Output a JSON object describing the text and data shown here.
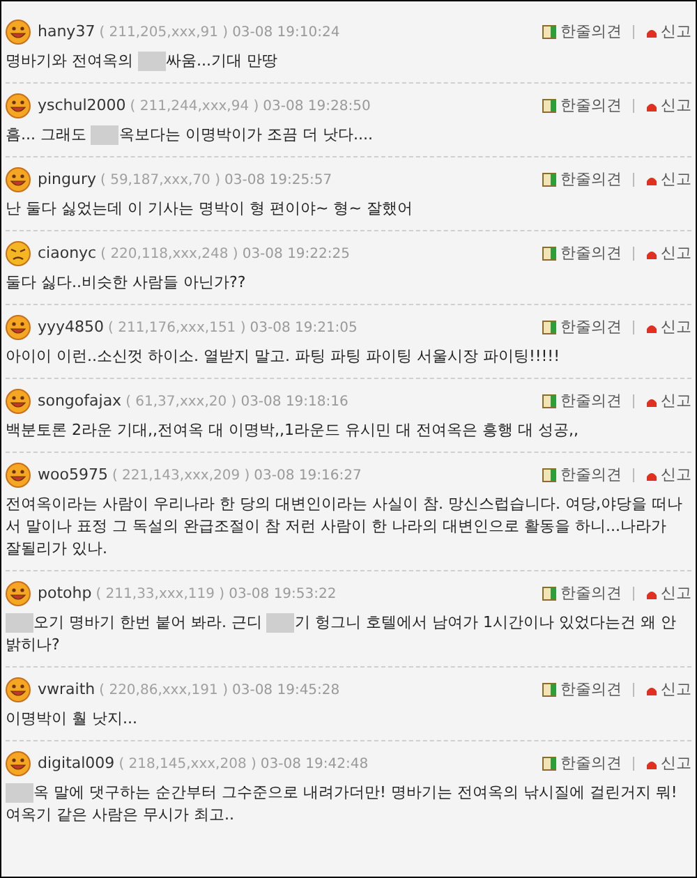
{
  "comments": [
    {
      "user": "hany37",
      "ip": "( 211,205,xxx,91 )",
      "time": "03-08 19:10:24",
      "frowning": false,
      "reply": "한줄의견",
      "report": "신고",
      "body": [
        {
          "kind": "text",
          "text": "명바기와 전여옥의 "
        },
        {
          "kind": "mask"
        },
        {
          "kind": "text",
          "text": "싸움...기대 만땅"
        }
      ]
    },
    {
      "user": "yschul2000",
      "ip": "( 211,244,xxx,94 )",
      "time": "03-08 19:28:50",
      "frowning": false,
      "reply": "한줄의견",
      "report": "신고",
      "body": [
        {
          "kind": "text",
          "text": "흠... 그래도 "
        },
        {
          "kind": "mask"
        },
        {
          "kind": "text",
          "text": "옥보다는 이명박이가 조끔 더 낫다...."
        }
      ]
    },
    {
      "user": "pingury",
      "ip": "( 59,187,xxx,70 )",
      "time": "03-08 19:25:57",
      "frowning": false,
      "reply": "한줄의견",
      "report": "신고",
      "body": [
        {
          "kind": "text",
          "text": "난 둘다 싫었는데 이 기사는 명박이 형 편이야~ 형~ 잘했어"
        }
      ]
    },
    {
      "user": "ciaonyc",
      "ip": "( 220,118,xxx,248 )",
      "time": "03-08 19:22:25",
      "frowning": true,
      "reply": "한줄의견",
      "report": "신고",
      "body": [
        {
          "kind": "text",
          "text": "둘다 싫다..비슷한 사람들 아닌가??"
        }
      ]
    },
    {
      "user": "yyy4850",
      "ip": "( 211,176,xxx,151 )",
      "time": "03-08 19:21:05",
      "frowning": false,
      "reply": "한줄의견",
      "report": "신고",
      "body": [
        {
          "kind": "text",
          "text": "아이이 이런..소신껏 하이소. 열받지 말고. 파팅 파팅 파이팅 서울시장 파이팅!!!!!"
        }
      ]
    },
    {
      "user": "songofajax",
      "ip": "( 61,37,xxx,20 )",
      "time": "03-08 19:18:16",
      "frowning": false,
      "reply": "한줄의견",
      "report": "신고",
      "body": [
        {
          "kind": "text",
          "text": "백분토론 2라운 기대,,전여옥 대 이명박,,1라운드 유시민 대 전여옥은 흥행 대 성공,,"
        }
      ]
    },
    {
      "user": "woo5975",
      "ip": "( 221,143,xxx,209 )",
      "time": "03-08 19:16:27",
      "frowning": false,
      "reply": "한줄의견",
      "report": "신고",
      "body": [
        {
          "kind": "text",
          "text": "전여옥이라는 사람이 우리나라 한 당의 대변인이라는 사실이 참. 망신스럽습니다. 여당,야당을 떠나서 말이나 표정 그 독설의 완급조절이 참 저런 사람이 한 나라의 대변인으로 활동을 하니...나라가 잘될리가 있나."
        }
      ]
    },
    {
      "user": "potohp",
      "ip": "( 211,33,xxx,119 )",
      "time": "03-08 19:53:22",
      "frowning": false,
      "reply": "한줄의견",
      "report": "신고",
      "body": [
        {
          "kind": "mask"
        },
        {
          "kind": "text",
          "text": "오기 명바기 한번 붙어 봐라. 근디 "
        },
        {
          "kind": "mask"
        },
        {
          "kind": "text",
          "text": "기 헝그니 호텔에서 남여가 1시간이나 있었다는건 왜 안밝히나?"
        }
      ]
    },
    {
      "user": "vwraith",
      "ip": "( 220,86,xxx,191 )",
      "time": "03-08 19:45:28",
      "frowning": false,
      "reply": "한줄의견",
      "report": "신고",
      "body": [
        {
          "kind": "text",
          "text": "이명박이 훨 낫지..."
        }
      ]
    },
    {
      "user": "digital009",
      "ip": "( 218,145,xxx,208 )",
      "time": "03-08 19:42:48",
      "frowning": false,
      "reply": "한줄의견",
      "report": "신고",
      "body": [
        {
          "kind": "mask"
        },
        {
          "kind": "text",
          "text": "옥 말에 댓구하는 순간부터 그수준으로 내려가더만! 명바기는 전여옥의 낚시질에 걸린거지 뭐! 여옥기 같은 사람은 무시가 최고.."
        }
      ]
    }
  ]
}
